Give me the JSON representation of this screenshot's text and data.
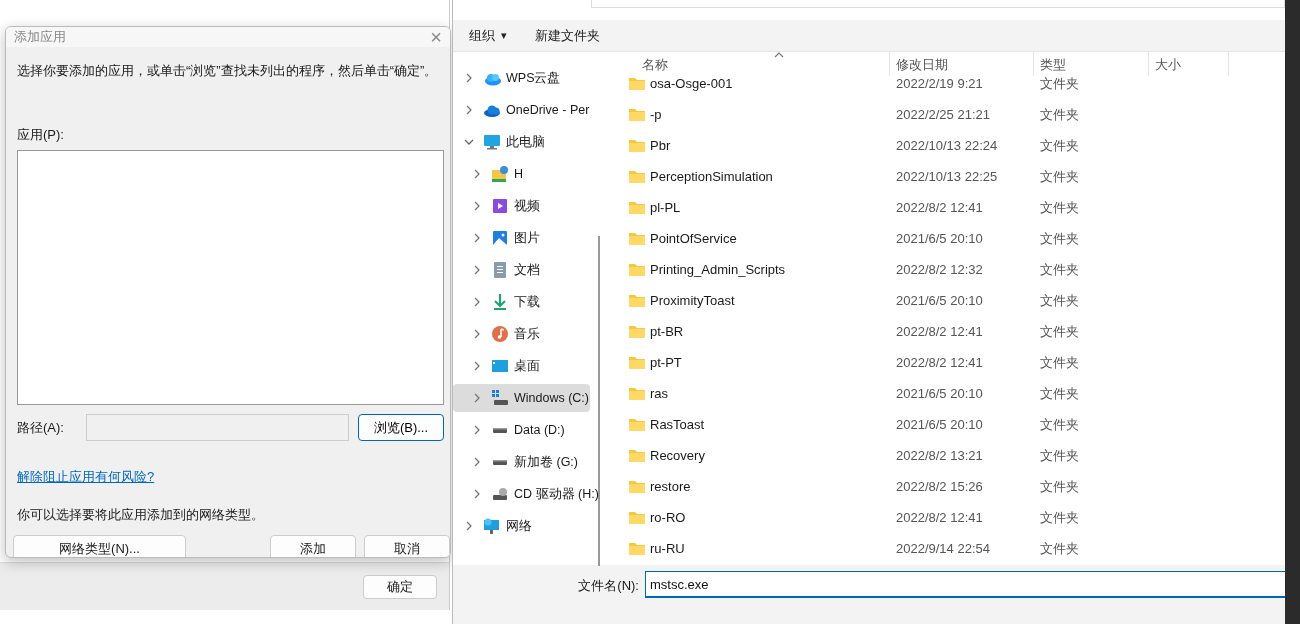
{
  "background_window": {
    "ok_button": "确定"
  },
  "add_app_dialog": {
    "title": "添加应用",
    "close": "×",
    "instruction": "选择你要添加的应用，或单击“浏览”查找未列出的程序，然后单击“确定”。",
    "apps_label": "应用(P):",
    "path_label": "路径(A):",
    "browse_button": "浏览(B)...",
    "risk_link": "解除阻止应用有何风险?",
    "network_note": "你可以选择要将此应用添加到的网络类型。",
    "network_type_button": "网络类型(N)...",
    "add_button": "添加",
    "cancel_button": "取消"
  },
  "file_dialog": {
    "toolbar": [
      {
        "label": "组织",
        "dropdown": "▾"
      },
      {
        "label": "新建文件夹"
      }
    ],
    "nav": [
      {
        "label": "WPS云盘",
        "kind": "cloud",
        "expanded": false,
        "selected": false
      },
      {
        "label": "OneDrive - Per",
        "kind": "onedrive",
        "expanded": false,
        "selected": false
      },
      {
        "label": "此电脑",
        "kind": "pc",
        "expanded": true,
        "selected": false,
        "children": [
          {
            "label": "H",
            "kind": "netdrive",
            "expanded": false,
            "selected": false
          },
          {
            "label": "视频",
            "kind": "video",
            "expanded": false,
            "selected": false
          },
          {
            "label": "图片",
            "kind": "pictures",
            "expanded": false,
            "selected": false
          },
          {
            "label": "文档",
            "kind": "documents",
            "expanded": false,
            "selected": false
          },
          {
            "label": "下载",
            "kind": "downloads",
            "expanded": false,
            "selected": false
          },
          {
            "label": "音乐",
            "kind": "music",
            "expanded": false,
            "selected": false
          },
          {
            "label": "桌面",
            "kind": "desktop",
            "expanded": false,
            "selected": false
          },
          {
            "label": "Windows (C:)",
            "kind": "windrive",
            "expanded": false,
            "selected": true
          },
          {
            "label": "Data (D:)",
            "kind": "drive",
            "expanded": false,
            "selected": false
          },
          {
            "label": "新加卷 (G:)",
            "kind": "drive",
            "expanded": false,
            "selected": false
          },
          {
            "label": "CD 驱动器 (H:)",
            "kind": "cd",
            "expanded": false,
            "selected": false
          }
        ]
      },
      {
        "label": "网络",
        "kind": "network",
        "expanded": false,
        "selected": false
      }
    ],
    "columns": [
      "名称",
      "修改日期",
      "类型",
      "大小"
    ],
    "rows": [
      {
        "name": "osa-Osge-001",
        "modified": "2022/2/19 9:21",
        "type": "文件夹"
      },
      {
        "name": "-p",
        "modified": "2022/2/25 21:21",
        "type": "文件夹"
      },
      {
        "name": "Pbr",
        "modified": "2022/10/13 22:24",
        "type": "文件夹"
      },
      {
        "name": "PerceptionSimulation",
        "modified": "2022/10/13 22:25",
        "type": "文件夹"
      },
      {
        "name": "pl-PL",
        "modified": "2022/8/2 12:41",
        "type": "文件夹"
      },
      {
        "name": "PointOfService",
        "modified": "2021/6/5 20:10",
        "type": "文件夹"
      },
      {
        "name": "Printing_Admin_Scripts",
        "modified": "2022/8/2 12:32",
        "type": "文件夹"
      },
      {
        "name": "ProximityToast",
        "modified": "2021/6/5 20:10",
        "type": "文件夹"
      },
      {
        "name": "pt-BR",
        "modified": "2022/8/2 12:41",
        "type": "文件夹"
      },
      {
        "name": "pt-PT",
        "modified": "2022/8/2 12:41",
        "type": "文件夹"
      },
      {
        "name": "ras",
        "modified": "2021/6/5 20:10",
        "type": "文件夹"
      },
      {
        "name": "RasToast",
        "modified": "2021/6/5 20:10",
        "type": "文件夹"
      },
      {
        "name": "Recovery",
        "modified": "2022/8/2 13:21",
        "type": "文件夹"
      },
      {
        "name": "restore",
        "modified": "2022/8/2 15:26",
        "type": "文件夹"
      },
      {
        "name": "ro-RO",
        "modified": "2022/8/2 12:41",
        "type": "文件夹"
      },
      {
        "name": "ru-RU",
        "modified": "2022/9/14 22:54",
        "type": "文件夹"
      }
    ],
    "filename_label": "文件名(N):",
    "filename_value": "mstsc.exe"
  }
}
